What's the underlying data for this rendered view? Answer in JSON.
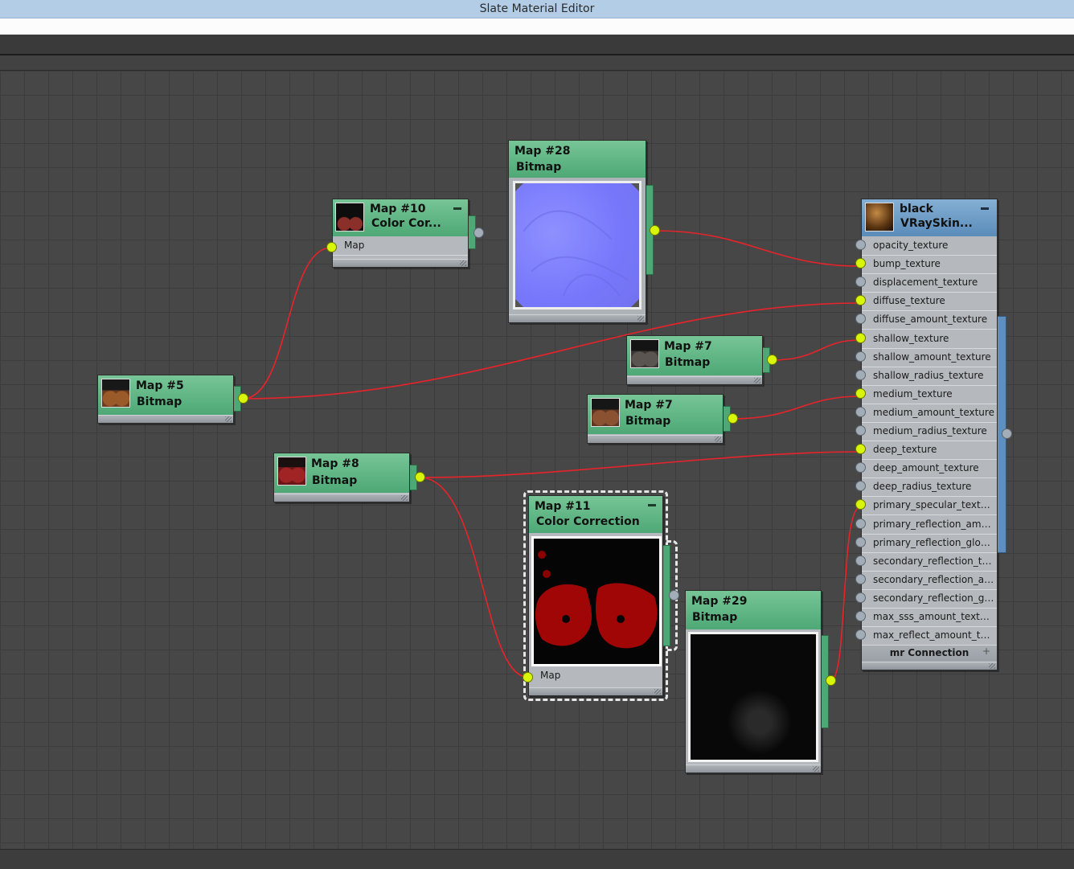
{
  "window": {
    "title": "Slate Material Editor"
  },
  "nodes": {
    "map28": {
      "name": "Map #28",
      "type": "Bitmap"
    },
    "map10": {
      "name": "Map #10",
      "type": "Color Cor...",
      "slot": "Map"
    },
    "map5": {
      "name": "Map #5",
      "type": "Bitmap"
    },
    "map7a": {
      "name": "Map #7",
      "type": "Bitmap"
    },
    "map7b": {
      "name": "Map #7",
      "type": "Bitmap"
    },
    "map8": {
      "name": "Map #8",
      "type": "Bitmap"
    },
    "map11": {
      "name": "Map #11",
      "type": "Color Correction",
      "slot": "Map"
    },
    "map29": {
      "name": "Map #29",
      "type": "Bitmap"
    },
    "material": {
      "name": "black",
      "type": "VRaySkin...",
      "footer": "mr Connection",
      "slots": [
        {
          "label": "opacity_texture",
          "connected": false
        },
        {
          "label": "bump_texture",
          "connected": true
        },
        {
          "label": "displacement_texture",
          "connected": false
        },
        {
          "label": "diffuse_texture",
          "connected": true
        },
        {
          "label": "diffuse_amount_texture",
          "connected": false
        },
        {
          "label": "shallow_texture",
          "connected": true
        },
        {
          "label": "shallow_amount_texture",
          "connected": false
        },
        {
          "label": "shallow_radius_texture",
          "connected": false
        },
        {
          "label": "medium_texture",
          "connected": true
        },
        {
          "label": "medium_amount_texture",
          "connected": false
        },
        {
          "label": "medium_radius_texture",
          "connected": false
        },
        {
          "label": "deep_texture",
          "connected": true
        },
        {
          "label": "deep_amount_texture",
          "connected": false
        },
        {
          "label": "deep_radius_texture",
          "connected": false
        },
        {
          "label": "primary_specular_texture",
          "connected": true
        },
        {
          "label": "primary_reflection_amou...",
          "connected": false
        },
        {
          "label": "primary_reflection_glossi...",
          "connected": false
        },
        {
          "label": "secondary_reflection_tex...",
          "connected": false
        },
        {
          "label": "secondary_reflection_am...",
          "connected": false
        },
        {
          "label": "secondary_reflection_glo...",
          "connected": false
        },
        {
          "label": "max_sss_amount_texture",
          "connected": false
        },
        {
          "label": "max_reflect_amount_text...",
          "connected": false
        }
      ]
    }
  },
  "colors": {
    "wire": "#e8232a",
    "socket_connected": "#d9f50a",
    "socket_free": "#a3adb8",
    "node_header": "#5cb784",
    "material_header": "#6b9bc7"
  }
}
